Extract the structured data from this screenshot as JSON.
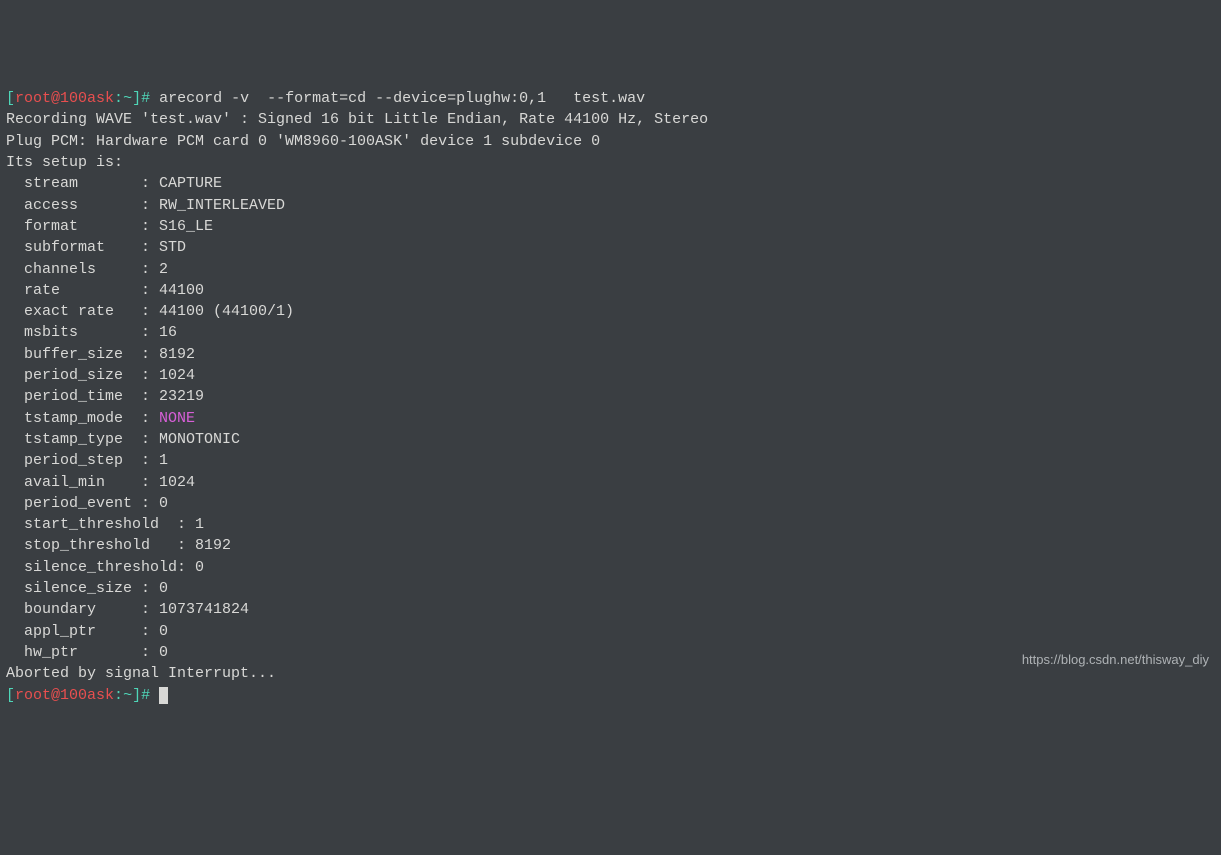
{
  "prompt1": {
    "open": "[",
    "user": "root@100ask",
    "sep": ":",
    "path": "~",
    "close": "]#",
    "command": " arecord -v  --format=cd --device=plughw:0,1   test.wav"
  },
  "output": {
    "line1": "Recording WAVE 'test.wav' : Signed 16 bit Little Endian, Rate 44100 Hz, Stereo",
    "line2": "Plug PCM: Hardware PCM card 0 'WM8960-100ASK' device 1 subdevice 0",
    "line3": "Its setup is:",
    "params": [
      {
        "key": "  stream       : ",
        "value": "CAPTURE"
      },
      {
        "key": "  access       : ",
        "value": "RW_INTERLEAVED"
      },
      {
        "key": "  format       : ",
        "value": "S16_LE"
      },
      {
        "key": "  subformat    : ",
        "value": "STD"
      },
      {
        "key": "  channels     : ",
        "value": "2"
      },
      {
        "key": "  rate         : ",
        "value": "44100"
      },
      {
        "key": "  exact rate   : ",
        "value": "44100 (44100/1)"
      },
      {
        "key": "  msbits       : ",
        "value": "16"
      },
      {
        "key": "  buffer_size  : ",
        "value": "8192"
      },
      {
        "key": "  period_size  : ",
        "value": "1024"
      },
      {
        "key": "  period_time  : ",
        "value": "23219"
      },
      {
        "key": "  tstamp_mode  : ",
        "value": "NONE",
        "highlight": true
      },
      {
        "key": "  tstamp_type  : ",
        "value": "MONOTONIC"
      },
      {
        "key": "  period_step  : ",
        "value": "1"
      },
      {
        "key": "  avail_min    : ",
        "value": "1024"
      },
      {
        "key": "  period_event : ",
        "value": "0"
      },
      {
        "key": "  start_threshold  : ",
        "value": "1"
      },
      {
        "key": "  stop_threshold   : ",
        "value": "8192"
      },
      {
        "key": "  silence_threshold: ",
        "value": "0"
      },
      {
        "key": "  silence_size : ",
        "value": "0"
      },
      {
        "key": "  boundary     : ",
        "value": "1073741824"
      },
      {
        "key": "  appl_ptr     : ",
        "value": "0"
      },
      {
        "key": "  hw_ptr       : ",
        "value": "0"
      }
    ],
    "interrupt": "Aborted by signal Interrupt..."
  },
  "prompt2": {
    "open": "[",
    "user": "root@100ask",
    "sep": ":",
    "path": "~",
    "close": "]#",
    "command": " "
  },
  "watermark": "https://blog.csdn.net/thisway_diy"
}
